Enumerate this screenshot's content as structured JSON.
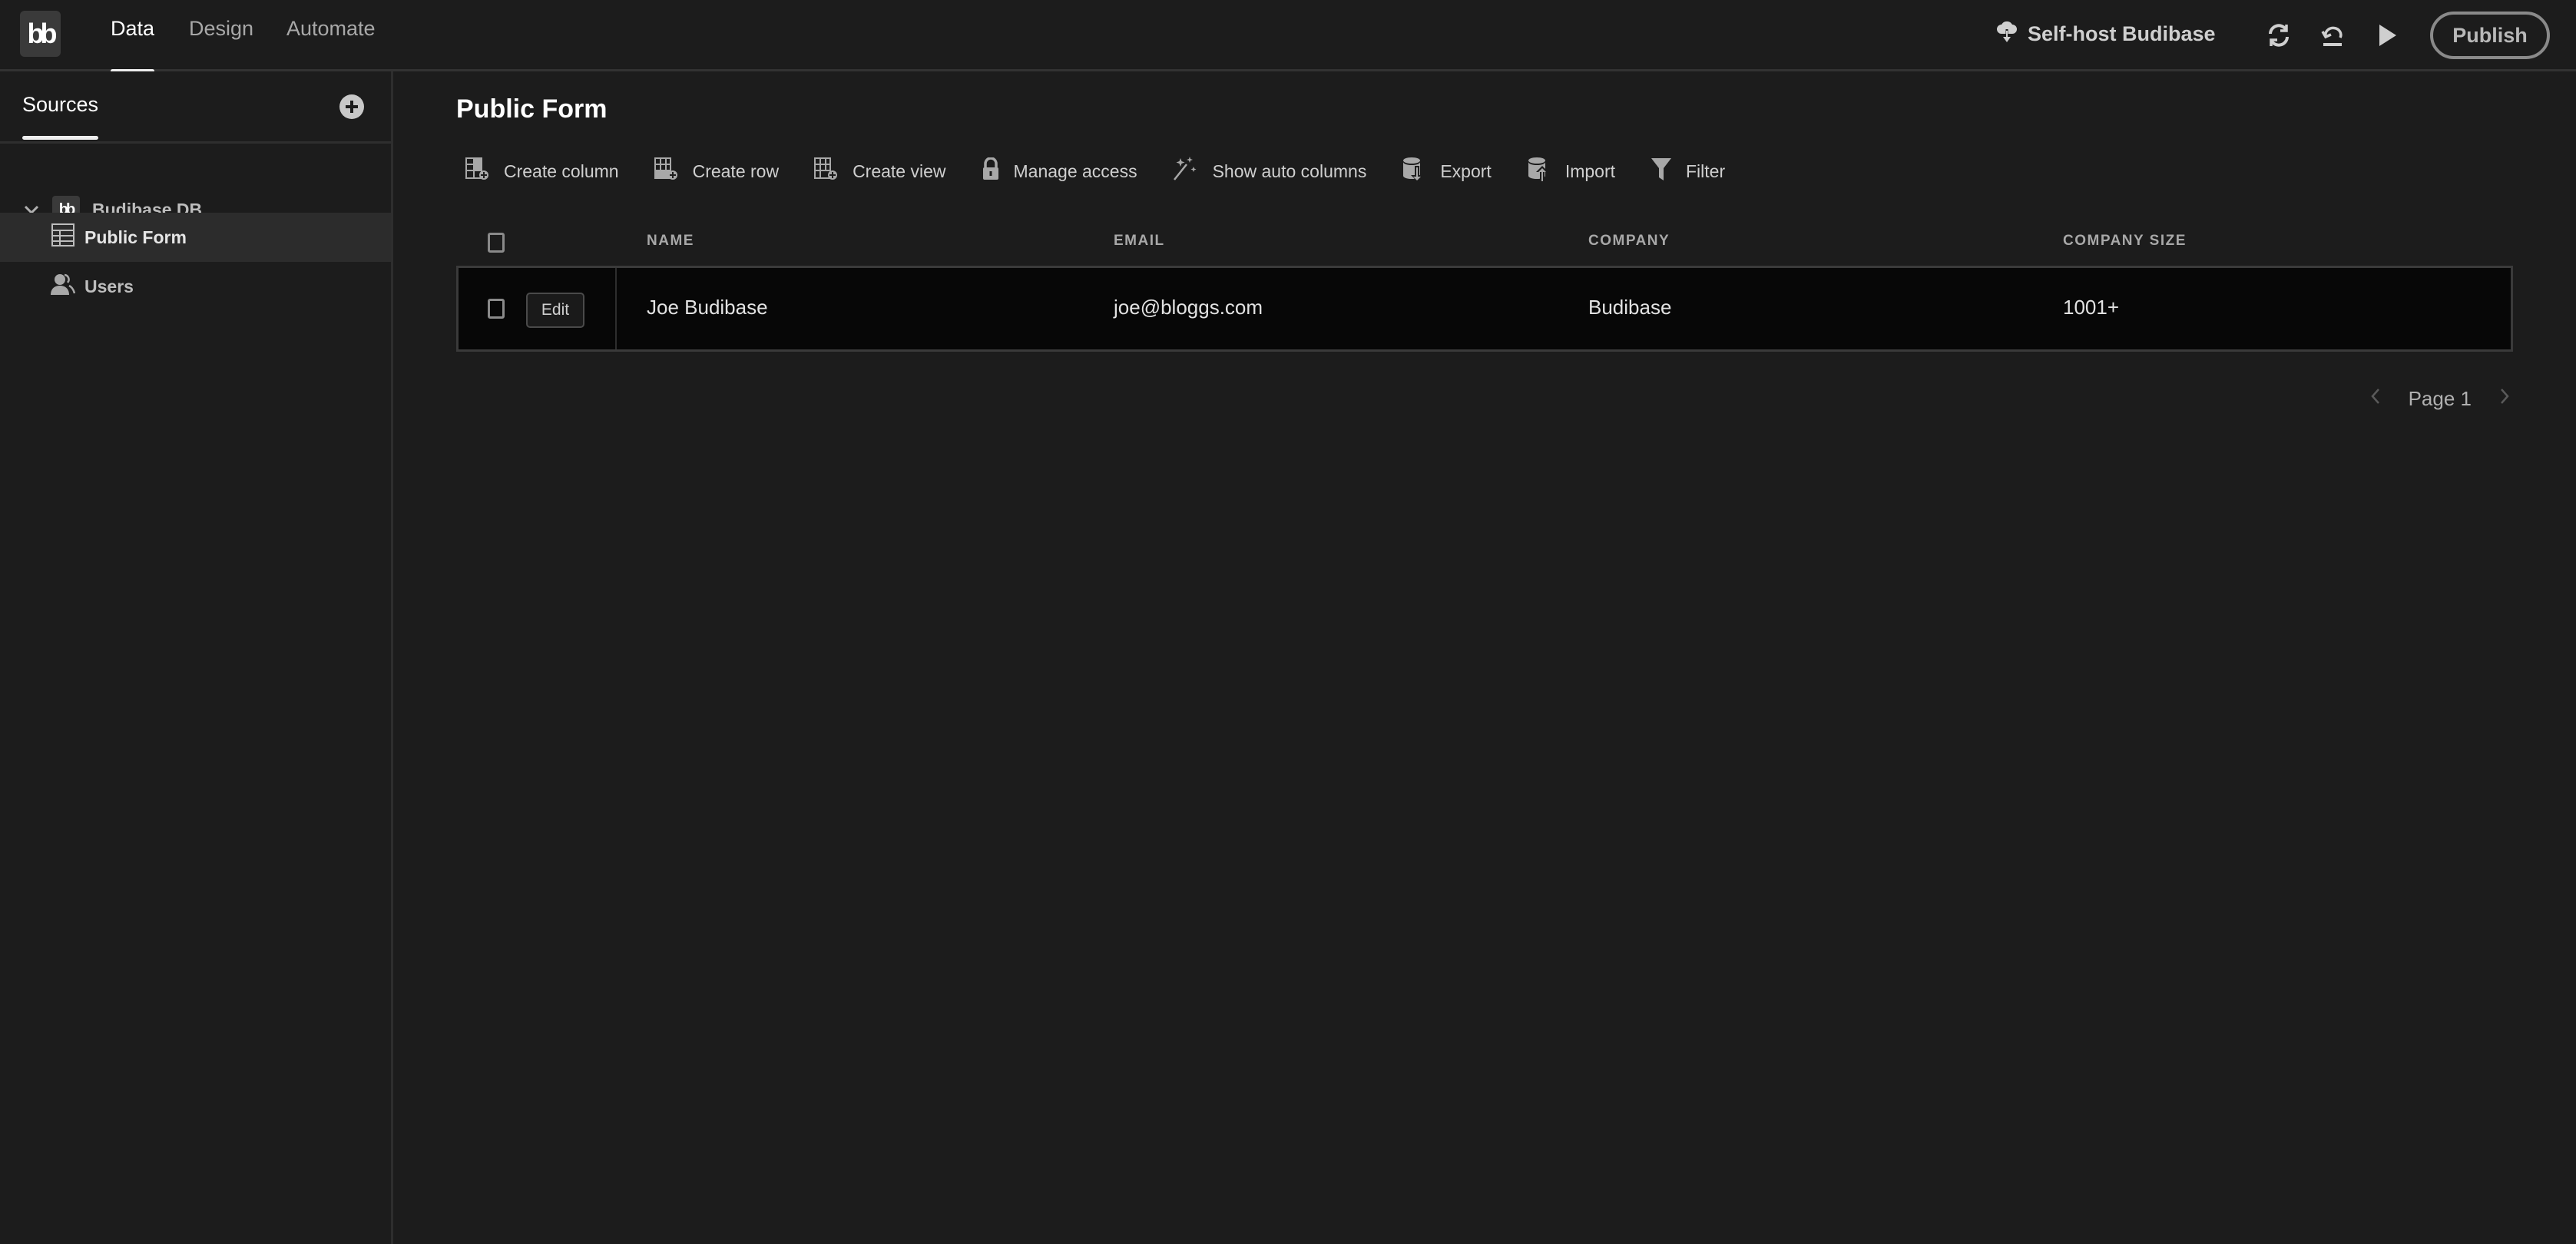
{
  "topbar": {
    "logo": "bb",
    "tabs": [
      {
        "label": "Data",
        "active": true
      },
      {
        "label": "Design",
        "active": false
      },
      {
        "label": "Automate",
        "active": false
      }
    ],
    "self_host_label": "Self-host Budibase",
    "icons": [
      "refresh-icon",
      "undo-icon",
      "play-icon"
    ],
    "publish_label": "Publish"
  },
  "sidebar": {
    "title": "Sources",
    "add_icon": "add-circle-icon",
    "datasource": {
      "label": "Budibase DB",
      "logo": "bb",
      "expanded": true
    },
    "tables": [
      {
        "label": "Public Form",
        "icon": "table-icon",
        "selected": true
      },
      {
        "label": "Users",
        "icon": "users-icon",
        "selected": false
      }
    ]
  },
  "main": {
    "title": "Public Form",
    "toolbar": [
      {
        "label": "Create column",
        "icon": "create-column-icon"
      },
      {
        "label": "Create row",
        "icon": "create-row-icon"
      },
      {
        "label": "Create view",
        "icon": "create-view-icon"
      },
      {
        "label": "Manage access",
        "icon": "lock-icon"
      },
      {
        "label": "Show auto columns",
        "icon": "magic-wand-icon"
      },
      {
        "label": "Export",
        "icon": "database-export-icon"
      },
      {
        "label": "Import",
        "icon": "database-import-icon"
      },
      {
        "label": "Filter",
        "icon": "filter-icon"
      }
    ],
    "table": {
      "columns": [
        "NAME",
        "EMAIL",
        "COMPANY",
        "COMPANY SIZE"
      ],
      "edit_label": "Edit",
      "rows": [
        [
          "Joe Budibase",
          "joe@bloggs.com",
          "Budibase",
          "1001+"
        ]
      ]
    },
    "pagination": {
      "label": "Page 1"
    }
  },
  "colors": {
    "background": "#1c1c1c",
    "row_background": "#070707",
    "text_primary": "#ffffff",
    "text_muted": "#a8a8a8"
  }
}
